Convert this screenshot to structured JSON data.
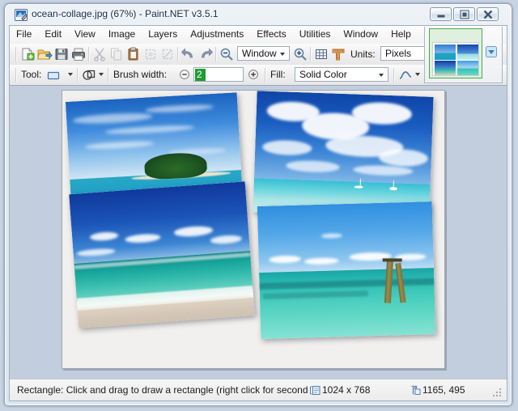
{
  "window": {
    "title": "ocean-collage.jpg (67%) - Paint.NET v3.5.1",
    "icon": "paintnet-app-icon",
    "controls": {
      "minimize": "Minimize",
      "maximize": "Maximize",
      "close": "Close"
    }
  },
  "menu": {
    "items": [
      {
        "label": "File"
      },
      {
        "label": "Edit"
      },
      {
        "label": "View"
      },
      {
        "label": "Image"
      },
      {
        "label": "Layers"
      },
      {
        "label": "Adjustments"
      },
      {
        "label": "Effects"
      },
      {
        "label": "Utilities"
      },
      {
        "label": "Window"
      },
      {
        "label": "Help"
      }
    ]
  },
  "toolbar_main": {
    "buttons": [
      {
        "name": "new-image",
        "icon": "new-file-icon"
      },
      {
        "name": "open-image",
        "icon": "open-folder-icon"
      },
      {
        "name": "save-image",
        "icon": "save-floppy-icon"
      },
      {
        "name": "print-image",
        "icon": "printer-icon"
      },
      {
        "name": "cut",
        "icon": "scissors-icon"
      },
      {
        "name": "copy",
        "icon": "copy-pages-icon"
      },
      {
        "name": "paste",
        "icon": "clipboard-icon"
      },
      {
        "name": "crop-to-selection",
        "icon": "crop-icon"
      },
      {
        "name": "deselect-all",
        "icon": "deselect-icon"
      },
      {
        "name": "undo",
        "icon": "undo-arrow-icon"
      },
      {
        "name": "redo",
        "icon": "redo-arrow-icon"
      },
      {
        "name": "zoom-out",
        "icon": "magnifier-minus-icon"
      },
      {
        "name": "zoom-in",
        "icon": "magnifier-plus-icon"
      },
      {
        "name": "toggle-grid",
        "icon": "grid-icon"
      },
      {
        "name": "toggle-rulers",
        "icon": "rulers-icon"
      }
    ],
    "zoom_combo": {
      "value": "Window"
    },
    "units_label": "Units:",
    "units_combo": {
      "value": "Pixels"
    }
  },
  "toolbar_tool": {
    "tool_label": "Tool:",
    "tool_icon": "rectangle-select-icon",
    "selection_mode_icon": "selection-mode-icon",
    "brush_width_label": "Brush width:",
    "brush_width_value": "2",
    "fill_label": "Fill:",
    "fill_combo": {
      "value": "Solid Color"
    },
    "antialias_icon": "antialiasing-curve-icon",
    "blend_icon": "blend-mode-flask-icon"
  },
  "thumbnail_strip": {
    "active_thumbnail": "ocean-collage.jpg",
    "dropdown_icon": "image-list-dropdown-icon"
  },
  "canvas": {
    "document_name": "ocean-collage.jpg",
    "background_color": "#f1f0ee",
    "photos": [
      {
        "name": "island-photo",
        "caption": "tropical island with palm trees"
      },
      {
        "name": "clouds-photo",
        "caption": "clouds over turquoise sea with sailboats"
      },
      {
        "name": "beach-surf-photo",
        "caption": "sandy beach with breaking surf"
      },
      {
        "name": "pilings-photo",
        "caption": "wooden pilings in turquoise water"
      }
    ]
  },
  "status_bar": {
    "message": "Rectangle: Click and drag to draw a rectangle (right click for second",
    "image_size_icon": "image-size-icon",
    "image_size": "1024 x 768",
    "cursor_position_icon": "cursor-position-icon",
    "cursor_position": "1165, 495",
    "resize_grip": "resize-grip"
  },
  "colors": {
    "accent": "#1f9b31",
    "title_text": "#102a46",
    "workspace": "#c2cede"
  }
}
